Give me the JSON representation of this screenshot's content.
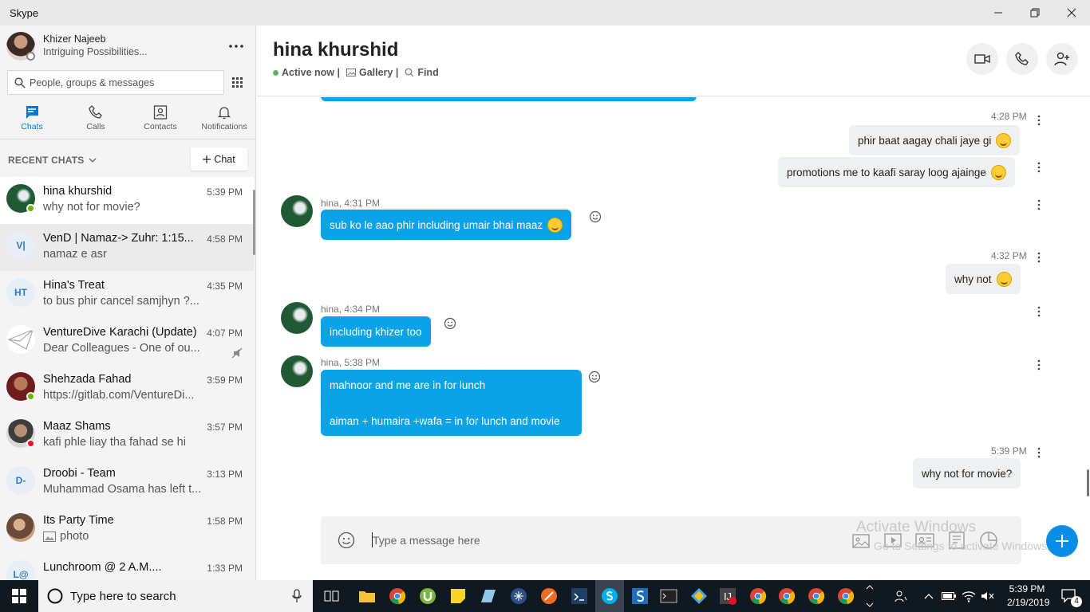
{
  "window": {
    "title": "Skype"
  },
  "profile": {
    "name": "Khizer Najeeb",
    "mood": "Intriguing Possibilities..."
  },
  "search": {
    "placeholder": "People, groups & messages"
  },
  "nav": {
    "chats": "Chats",
    "calls": "Calls",
    "contacts": "Contacts",
    "notifications": "Notifications"
  },
  "recent": {
    "label": "RECENT CHATS",
    "new_chat": "Chat"
  },
  "chats": [
    {
      "name": "hina khurshid",
      "time": "5:39 PM",
      "preview": "why not for movie?",
      "initials": "",
      "status": "online"
    },
    {
      "name": "VenD | Namaz-> Zuhr: 1:15...",
      "time": "4:58 PM",
      "preview": "namaz e asr",
      "initials": "V|",
      "status": ""
    },
    {
      "name": "Hina's Treat",
      "time": "4:35 PM",
      "preview": "to bus phir cancel samjhyn ?...",
      "initials": "HT",
      "status": ""
    },
    {
      "name": "VentureDive Karachi (Update)",
      "time": "4:07 PM",
      "preview": "Dear Colleagues - One of ou...",
      "initials": "",
      "status": "muted"
    },
    {
      "name": "Shehzada Fahad",
      "time": "3:59 PM",
      "preview": "https://gitlab.com/VentureDi...",
      "initials": "",
      "status": "online"
    },
    {
      "name": "Maaz Shams",
      "time": "3:57 PM",
      "preview": "kafi phle liay tha fahad se hi",
      "initials": "",
      "status": "dnd"
    },
    {
      "name": "Droobi - Team",
      "time": "3:13 PM",
      "preview": "Muhammad Osama has left t...",
      "initials": "D-",
      "status": ""
    },
    {
      "name": "Its Party Time",
      "time": "1:58 PM",
      "preview": "photo",
      "initials": "",
      "status": ""
    },
    {
      "name": "Lunchroom @ 2 A.M....",
      "time": "1:33 PM",
      "preview": "",
      "initials": "L@",
      "status": ""
    }
  ],
  "conversation": {
    "title": "hina khurshid",
    "status": "Active now |",
    "gallery": "Gallery |",
    "find": "Find"
  },
  "messages": {
    "m1_time": "4:28 PM",
    "m1_a": "phir baat aagay chali jaye gi",
    "m1_b": "promotions me to kaafi saray loog ajainge",
    "m2_time": "hina, 4:31 PM",
    "m2": "sub ko le aao phir including umair bhai maaz",
    "m3_time": "4:32 PM",
    "m3": "why not",
    "m4_time": "hina, 4:34 PM",
    "m4": "including khizer too",
    "m5_time": "hina, 5:38 PM",
    "m5_line1": "mahnoor and me are in for lunch",
    "m5_line2": "aiman + humaira +wafa = in for lunch and movie",
    "m6_time": "5:39 PM",
    "m6": "why not for movie?"
  },
  "composer": {
    "placeholder": "Type a message here"
  },
  "watermark": {
    "line1": "Activate Windows",
    "line2": "Go to Settings to activate Windows."
  },
  "taskbar": {
    "search_placeholder": "Type here to search",
    "time": "5:39 PM",
    "date": "2/19/2019",
    "notif_count": "4",
    "badge": "4"
  },
  "colors": {
    "accent": "#0078d4",
    "bubble_incoming": "#0ba3e8",
    "online": "#6bb700",
    "dnd": "#e81123"
  }
}
